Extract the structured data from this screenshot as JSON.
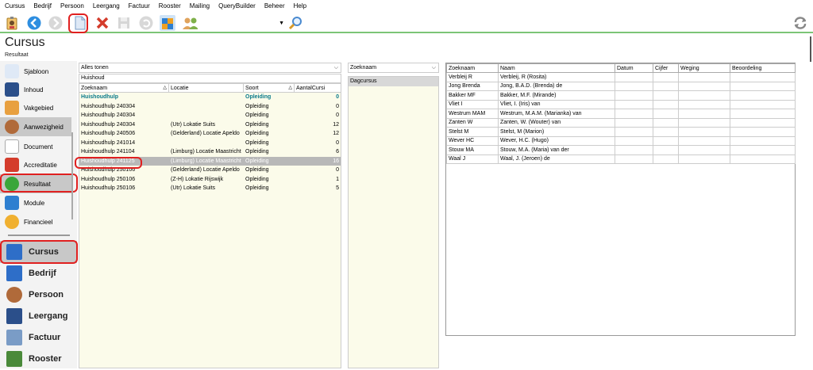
{
  "menu": [
    "Cursus",
    "Bedrijf",
    "Persoon",
    "Leergang",
    "Factuur",
    "Rooster",
    "Mailing",
    "QueryBuilder",
    "Beheer",
    "Help"
  ],
  "header": {
    "title": "Cursus",
    "subtitle": "Resultaat"
  },
  "toolbar": {
    "dropdown_value": ""
  },
  "sidebar": {
    "items": [
      "Sjabloon",
      "Inhoud",
      "Vakgebied",
      "Aanwezigheid",
      "Document",
      "Accreditatie",
      "Resultaat",
      "Module",
      "Financieel"
    ],
    "modules": [
      "Cursus",
      "Bedrijf",
      "Persoon",
      "Leergang",
      "Factuur",
      "Rooster"
    ]
  },
  "panel1": {
    "filter_value": "Alles tonen",
    "search_value": "Huishoud",
    "columns": [
      "Zoeknaam",
      "Locatie",
      "Soort",
      "AantalCursi"
    ],
    "rows": [
      {
        "zoeknaam": "Huishoudhulp",
        "locatie": "",
        "soort": "Opleiding",
        "aantal": "0"
      },
      {
        "zoeknaam": "Huishoudhulp 240304",
        "locatie": "",
        "soort": "Opleiding",
        "aantal": "0"
      },
      {
        "zoeknaam": "Huishoudhulp 240304",
        "locatie": "",
        "soort": "Opleiding",
        "aantal": "0"
      },
      {
        "zoeknaam": "Huishoudhulp 240304",
        "locatie": "(Utr) Lokatie Suits",
        "soort": "Opleiding",
        "aantal": "12"
      },
      {
        "zoeknaam": "Huishoudhulp 240506",
        "locatie": "(Gelderland) Locatie Apeldo",
        "soort": "Opleiding",
        "aantal": "12"
      },
      {
        "zoeknaam": "Huishoudhulp 241014",
        "locatie": "",
        "soort": "Opleiding",
        "aantal": "0"
      },
      {
        "zoeknaam": "Huishoudhulp 241104",
        "locatie": "(Limburg) Locatie Maastricht",
        "soort": "Opleiding",
        "aantal": "6"
      },
      {
        "zoeknaam": "Huishoudhulp 241125",
        "locatie": "(Limburg) Locatie Maastricht",
        "soort": "Opleiding",
        "aantal": "16"
      },
      {
        "zoeknaam": "Huishoudhulp 250106",
        "locatie": "(Gelderland) Locatie Apeldo",
        "soort": "Opleiding",
        "aantal": "0"
      },
      {
        "zoeknaam": "Huishoudhulp 250106",
        "locatie": "(Z-H) Lokatie Rijswijk",
        "soort": "Opleiding",
        "aantal": "1"
      },
      {
        "zoeknaam": "Huishoudhulp 250106",
        "locatie": "(Utr) Lokatie Suits",
        "soort": "Opleiding",
        "aantal": "5"
      }
    ]
  },
  "panel2": {
    "filter_value": "Zoeknaam",
    "items": [
      "Dagcursus"
    ]
  },
  "panel3": {
    "columns": [
      "Zoeknaam",
      "Naam",
      "Datum",
      "Cijfer",
      "Weging",
      "Beoordeling"
    ],
    "rows": [
      {
        "zoeknaam": "Verbleij R",
        "naam": "Verbleij, R (Rosita)"
      },
      {
        "zoeknaam": "Jong Brenda",
        "naam": "Jong, B.A.D. (Brenda) de"
      },
      {
        "zoeknaam": "Bakker MF",
        "naam": "Bakker, M.F. (Mirande)"
      },
      {
        "zoeknaam": "Vliet I",
        "naam": "Vliet, I. (Iris) van"
      },
      {
        "zoeknaam": "Westrum MAM",
        "naam": "Westrum, M.A.M. (Marianka) van"
      },
      {
        "zoeknaam": "Zanten W",
        "naam": "Zanten, W. (Wouter) van"
      },
      {
        "zoeknaam": "Stelst M",
        "naam": "Stelst, M (Marion)"
      },
      {
        "zoeknaam": "Wever HC",
        "naam": "Wever, H.C. (Hugo)"
      },
      {
        "zoeknaam": "Stouw MA",
        "naam": "Stouw, M.A. (Maria) van der"
      },
      {
        "zoeknaam": "Waal J",
        "naam": "Waal, J. (Jeroen) de"
      }
    ]
  },
  "colors": {
    "accent_green": "#7cc576",
    "group_teal": "#0a7a8a",
    "selected": "#b8b8b8",
    "annotation_red": "#e02020"
  }
}
